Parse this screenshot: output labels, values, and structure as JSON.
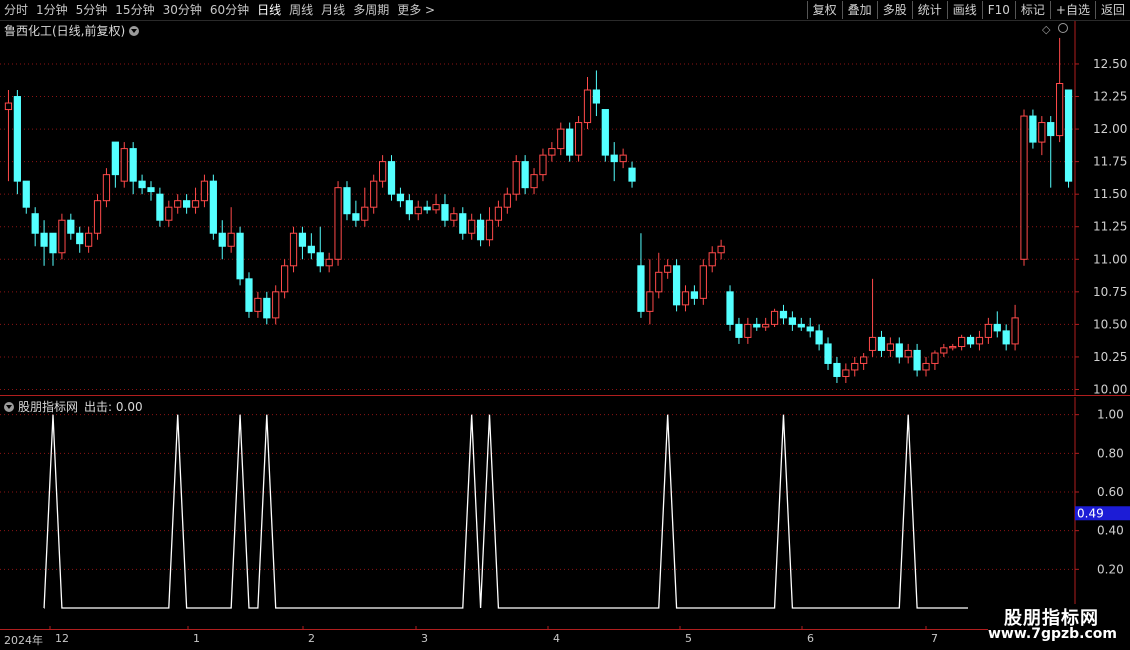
{
  "toolbar": {
    "periods": [
      "分时",
      "1分钟",
      "5分钟",
      "15分钟",
      "30分钟",
      "60分钟",
      "日线",
      "周线",
      "月线",
      "多周期",
      "更多 >"
    ],
    "active_period": "日线",
    "right_buttons": [
      "复权",
      "叠加",
      "多股",
      "统计",
      "画线",
      "F10",
      "标记",
      "+自选",
      "返回"
    ]
  },
  "main_chart": {
    "title": "鲁西化工(日线,前复权)",
    "y_ticks": [
      "12.50",
      "12.25",
      "12.00",
      "11.75",
      "11.50",
      "11.25",
      "11.00",
      "10.75",
      "10.50",
      "10.25",
      "10.00"
    ],
    "y_range": [
      9.95,
      12.83
    ]
  },
  "sub_chart": {
    "indicator_name": "股朋指标网",
    "output_label": "出击: 0.00",
    "y_ticks": [
      "1.00",
      "0.80",
      "0.60",
      "0.40",
      "0.20"
    ],
    "cursor_value": "0.49",
    "y_range": [
      0.0,
      1.05
    ]
  },
  "date_axis": {
    "year": "2024年",
    "months": [
      "12",
      "1",
      "2",
      "3",
      "4",
      "5",
      "6",
      "7"
    ]
  },
  "watermark": {
    "name": "股朋指标网",
    "url": "www.7gpzb.com"
  },
  "colors": {
    "up": "#ff4a4a",
    "down": "#54ffff",
    "grid": "#8b1414",
    "axis": "#b01e1e",
    "signal": "#ffffff",
    "cursor_bg": "#1c1cd6"
  },
  "chart_data": {
    "type": "candlestick",
    "series_open_close_high_low": [
      [
        12.15,
        12.2,
        12.3,
        11.6
      ],
      [
        12.25,
        11.6,
        12.3,
        11.5
      ],
      [
        11.6,
        11.4,
        11.6,
        11.35
      ],
      [
        11.35,
        11.2,
        11.4,
        11.1
      ],
      [
        11.2,
        11.1,
        11.3,
        10.95
      ],
      [
        11.2,
        11.05,
        11.2,
        10.95
      ],
      [
        11.05,
        11.3,
        11.35,
        11.0
      ],
      [
        11.3,
        11.2,
        11.35,
        11.15
      ],
      [
        11.2,
        11.12,
        11.25,
        11.05
      ],
      [
        11.1,
        11.2,
        11.25,
        11.05
      ],
      [
        11.2,
        11.45,
        11.5,
        11.15
      ],
      [
        11.45,
        11.65,
        11.7,
        11.4
      ],
      [
        11.9,
        11.65,
        11.9,
        11.55
      ],
      [
        11.6,
        11.85,
        11.9,
        11.55
      ],
      [
        11.85,
        11.6,
        11.9,
        11.5
      ],
      [
        11.6,
        11.55,
        11.65,
        11.5
      ],
      [
        11.55,
        11.52,
        11.6,
        11.45
      ],
      [
        11.5,
        11.3,
        11.55,
        11.25
      ],
      [
        11.3,
        11.4,
        11.45,
        11.25
      ],
      [
        11.4,
        11.45,
        11.5,
        11.35
      ],
      [
        11.45,
        11.4,
        11.5,
        11.35
      ],
      [
        11.4,
        11.45,
        11.55,
        11.35
      ],
      [
        11.45,
        11.6,
        11.65,
        11.4
      ],
      [
        11.6,
        11.2,
        11.65,
        11.15
      ],
      [
        11.2,
        11.1,
        11.3,
        11.0
      ],
      [
        11.1,
        11.2,
        11.4,
        11.05
      ],
      [
        11.2,
        10.85,
        11.25,
        10.8
      ],
      [
        10.85,
        10.6,
        10.9,
        10.55
      ],
      [
        10.6,
        10.7,
        10.75,
        10.55
      ],
      [
        10.7,
        10.55,
        10.75,
        10.5
      ],
      [
        10.55,
        10.75,
        10.8,
        10.5
      ],
      [
        10.75,
        10.95,
        11.0,
        10.7
      ],
      [
        10.95,
        11.2,
        11.25,
        10.9
      ],
      [
        11.2,
        11.1,
        11.25,
        11.0
      ],
      [
        11.1,
        11.05,
        11.2,
        11.0
      ],
      [
        11.05,
        10.95,
        11.25,
        10.9
      ],
      [
        10.95,
        11.0,
        11.05,
        10.9
      ],
      [
        11.0,
        11.55,
        11.6,
        10.95
      ],
      [
        11.55,
        11.35,
        11.6,
        11.3
      ],
      [
        11.35,
        11.3,
        11.45,
        11.25
      ],
      [
        11.3,
        11.4,
        11.55,
        11.25
      ],
      [
        11.4,
        11.6,
        11.65,
        11.35
      ],
      [
        11.6,
        11.75,
        11.8,
        11.55
      ],
      [
        11.75,
        11.5,
        11.8,
        11.45
      ],
      [
        11.5,
        11.45,
        11.55,
        11.4
      ],
      [
        11.45,
        11.35,
        11.5,
        11.3
      ],
      [
        11.35,
        11.4,
        11.45,
        11.3
      ],
      [
        11.4,
        11.38,
        11.45,
        11.35
      ],
      [
        11.38,
        11.42,
        11.5,
        11.35
      ],
      [
        11.42,
        11.3,
        11.5,
        11.25
      ],
      [
        11.3,
        11.35,
        11.4,
        11.25
      ],
      [
        11.35,
        11.2,
        11.4,
        11.15
      ],
      [
        11.2,
        11.3,
        11.35,
        11.15
      ],
      [
        11.3,
        11.15,
        11.35,
        11.1
      ],
      [
        11.15,
        11.3,
        11.4,
        11.1
      ],
      [
        11.3,
        11.4,
        11.45,
        11.25
      ],
      [
        11.4,
        11.5,
        11.55,
        11.35
      ],
      [
        11.5,
        11.75,
        11.8,
        11.45
      ],
      [
        11.75,
        11.55,
        11.8,
        11.5
      ],
      [
        11.55,
        11.65,
        11.7,
        11.5
      ],
      [
        11.65,
        11.8,
        11.85,
        11.6
      ],
      [
        11.8,
        11.85,
        11.9,
        11.75
      ],
      [
        11.85,
        12.0,
        12.05,
        11.8
      ],
      [
        12.0,
        11.8,
        12.05,
        11.75
      ],
      [
        11.8,
        12.05,
        12.1,
        11.75
      ],
      [
        12.05,
        12.3,
        12.4,
        12.0
      ],
      [
        12.3,
        12.2,
        12.45,
        12.1
      ],
      [
        12.15,
        11.8,
        12.15,
        11.75
      ],
      [
        11.8,
        11.75,
        11.9,
        11.6
      ],
      [
        11.75,
        11.8,
        11.85,
        11.7
      ],
      [
        11.7,
        11.6,
        11.75,
        11.55
      ],
      [
        10.95,
        10.6,
        11.2,
        10.55
      ],
      [
        10.6,
        10.75,
        11.0,
        10.5
      ],
      [
        10.75,
        10.9,
        11.05,
        10.7
      ],
      [
        10.9,
        10.95,
        11.0,
        10.85
      ],
      [
        10.95,
        10.65,
        11.0,
        10.6
      ],
      [
        10.65,
        10.75,
        10.8,
        10.6
      ],
      [
        10.75,
        10.7,
        10.8,
        10.65
      ],
      [
        10.7,
        10.95,
        11.0,
        10.65
      ],
      [
        10.95,
        11.05,
        11.1,
        10.9
      ],
      [
        11.05,
        11.1,
        11.15,
        11.0
      ],
      [
        10.75,
        10.5,
        10.8,
        10.45
      ],
      [
        10.5,
        10.4,
        10.55,
        10.35
      ],
      [
        10.4,
        10.5,
        10.55,
        10.35
      ],
      [
        10.5,
        10.48,
        10.55,
        10.45
      ],
      [
        10.48,
        10.5,
        10.55,
        10.45
      ],
      [
        10.5,
        10.6,
        10.62,
        10.48
      ],
      [
        10.6,
        10.55,
        10.65,
        10.5
      ],
      [
        10.55,
        10.5,
        10.6,
        10.45
      ],
      [
        10.5,
        10.48,
        10.55,
        10.45
      ],
      [
        10.48,
        10.45,
        10.55,
        10.4
      ],
      [
        10.45,
        10.35,
        10.5,
        10.3
      ],
      [
        10.35,
        10.2,
        10.4,
        10.15
      ],
      [
        10.2,
        10.1,
        10.25,
        10.05
      ],
      [
        10.1,
        10.15,
        10.2,
        10.05
      ],
      [
        10.15,
        10.2,
        10.25,
        10.1
      ],
      [
        10.2,
        10.25,
        10.28,
        10.15
      ],
      [
        10.3,
        10.4,
        10.85,
        10.25
      ],
      [
        10.4,
        10.3,
        10.45,
        10.25
      ],
      [
        10.3,
        10.35,
        10.4,
        10.25
      ],
      [
        10.35,
        10.25,
        10.4,
        10.2
      ],
      [
        10.25,
        10.3,
        10.35,
        10.2
      ],
      [
        10.3,
        10.15,
        10.35,
        10.1
      ],
      [
        10.15,
        10.2,
        10.25,
        10.1
      ],
      [
        10.2,
        10.28,
        10.3,
        10.15
      ],
      [
        10.28,
        10.32,
        10.35,
        10.25
      ],
      [
        10.32,
        10.33,
        10.35,
        10.3
      ],
      [
        10.33,
        10.4,
        10.42,
        10.3
      ],
      [
        10.4,
        10.35,
        10.42,
        10.32
      ],
      [
        10.35,
        10.4,
        10.45,
        10.3
      ],
      [
        10.4,
        10.5,
        10.55,
        10.35
      ],
      [
        10.5,
        10.45,
        10.6,
        10.4
      ],
      [
        10.45,
        10.35,
        10.5,
        10.3
      ],
      [
        10.35,
        10.55,
        10.65,
        10.3
      ],
      [
        11.0,
        12.1,
        12.15,
        10.95
      ],
      [
        12.1,
        11.9,
        12.15,
        11.85
      ],
      [
        11.9,
        12.05,
        12.1,
        11.8
      ],
      [
        12.05,
        11.95,
        12.1,
        11.55
      ],
      [
        11.95,
        12.35,
        12.7,
        11.9
      ],
      [
        12.3,
        11.6,
        12.3,
        11.55
      ]
    ],
    "signal_peaks_index": [
      5,
      19,
      26,
      29,
      52,
      54,
      74,
      87,
      101
    ]
  }
}
